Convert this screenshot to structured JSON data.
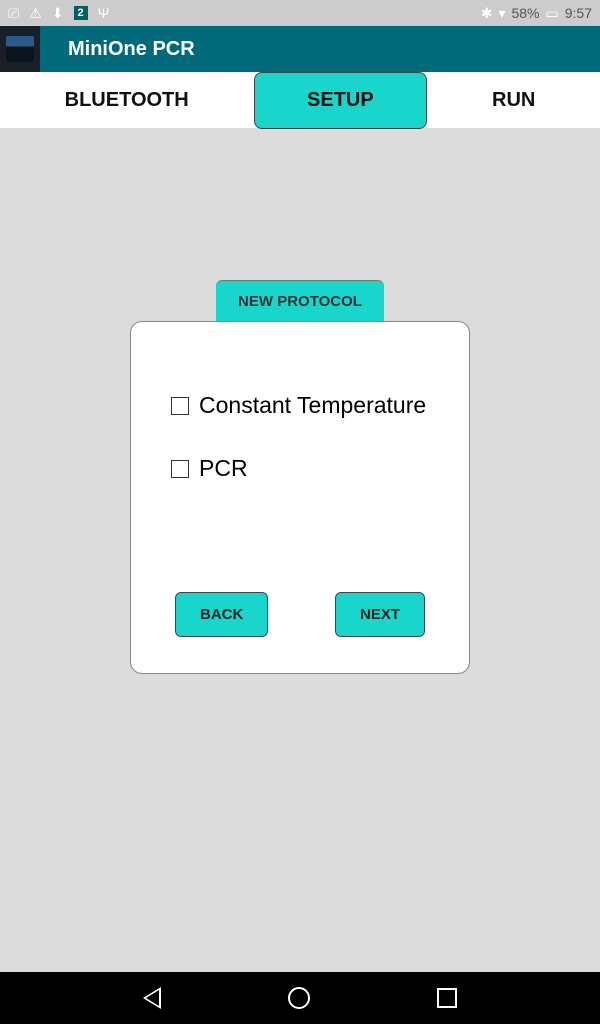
{
  "statusbar": {
    "battery_pct": "58%",
    "time": "9:57"
  },
  "titlebar": {
    "title": "MiniOne PCR"
  },
  "tabs": {
    "bluetooth": "BLUETOOTH",
    "setup": "SETUP",
    "run": "RUN"
  },
  "main": {
    "new_protocol": "NEW PROTOCOL",
    "options": {
      "constant_temp": "Constant Temperature",
      "pcr": "PCR"
    },
    "buttons": {
      "back": "BACK",
      "next": "NEXT"
    }
  }
}
